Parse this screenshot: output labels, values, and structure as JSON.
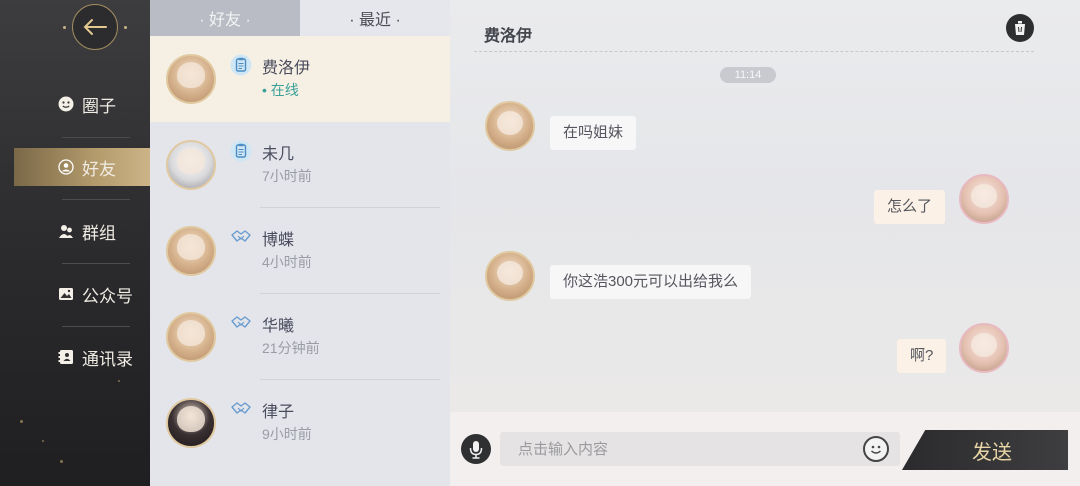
{
  "rail": {
    "items": [
      {
        "label": "圈子",
        "icon": "smiley-icon"
      },
      {
        "label": "好友",
        "icon": "friend-icon"
      },
      {
        "label": "群组",
        "icon": "group-icon"
      },
      {
        "label": "公众号",
        "icon": "picture-icon"
      },
      {
        "label": "通讯录",
        "icon": "contacts-icon"
      }
    ],
    "active_index": 1,
    "accent_color": "#b49b6c"
  },
  "tabs": [
    {
      "label": "· 好友 ·",
      "active": false
    },
    {
      "label": "· 最近 ·",
      "active": true
    }
  ],
  "contacts": [
    {
      "name": "费洛伊",
      "status": "• 在线",
      "badge": "clipboard-icon",
      "online": true
    },
    {
      "name": "未几",
      "status": "7小时前",
      "badge": "clipboard-icon",
      "online": false
    },
    {
      "name": "博蝶",
      "status": "4小时前",
      "badge": "handshake-icon",
      "online": false
    },
    {
      "name": "华曦",
      "status": "21分钟前",
      "badge": "handshake-icon",
      "online": false
    },
    {
      "name": "律子",
      "status": "9小时前",
      "badge": "handshake-icon",
      "online": false
    }
  ],
  "chat": {
    "title": "费洛伊",
    "timestamp": "11:14",
    "messages": [
      {
        "from": "them",
        "text": "在吗姐妹"
      },
      {
        "from": "me",
        "text": "怎么了"
      },
      {
        "from": "them",
        "text": "你这浩300元可以出给我么"
      },
      {
        "from": "me",
        "text": "啊?"
      }
    ],
    "input_placeholder": "点击输入内容",
    "send_label": "发送"
  }
}
